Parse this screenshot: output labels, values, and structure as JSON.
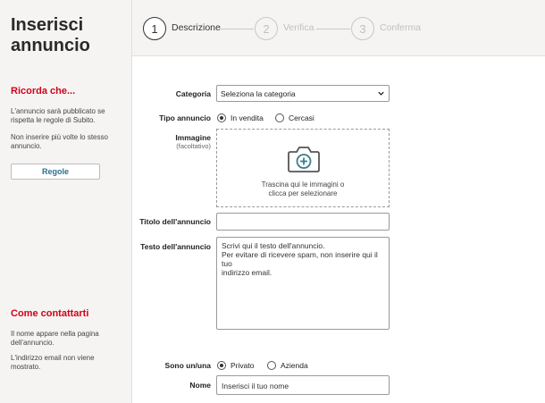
{
  "page": {
    "title_line1": "Inserisci",
    "title_line2": "annuncio"
  },
  "sidebar": {
    "reminder_heading": "Ricorda che...",
    "reminder_text1": "L'annuncio sarà pubblicato se rispetta le regole di Subito.",
    "reminder_text2": "Non inserire più volte lo stesso annuncio.",
    "rules_button": "Regole",
    "contact_heading": "Come contattarti",
    "contact_text1": "Il nome appare nella pagina dell'annuncio.",
    "contact_text2": "L'indirizzo email non viene mostrato."
  },
  "steps": [
    {
      "number": "1",
      "label": "Descrizione",
      "active": true
    },
    {
      "number": "2",
      "label": "Verifica",
      "active": false
    },
    {
      "number": "3",
      "label": "Conferma",
      "active": false
    }
  ],
  "form": {
    "category_label": "Categoria",
    "category_value": "Seleziona la categoria",
    "type_label": "Tipo annuncio",
    "type_option1": "In vendita",
    "type_option2": "Cercasi",
    "type_selected": "In vendita",
    "image_label": "Immagine",
    "image_sublabel": "(facoltativo)",
    "image_drop_line1": "Trascina qui le immagini o",
    "image_drop_line2": "clicca per selezionare",
    "ad_title_label": "Titolo dell'annuncio",
    "ad_title_value": "",
    "ad_text_label": "Testo dell'annuncio",
    "ad_text_placeholder_line1": "Scrivi qui il testo dell'annuncio.",
    "ad_text_placeholder_line2": "Per evitare di ricevere spam, non inserire qui il tuo",
    "ad_text_placeholder_line3": "indirizzo email.",
    "seller_label": "Sono un/una",
    "seller_option1": "Privato",
    "seller_option2": "Azienda",
    "seller_selected": "Privato",
    "name_label": "Nome",
    "name_placeholder": "Inserisci il tuo nome"
  },
  "colors": {
    "accent_red": "#d0021b",
    "link_blue": "#2b6f8f",
    "teal_icon": "#3a7d8c"
  },
  "icons": {
    "image_upload": "camera-plus-icon",
    "select_arrow": "chevron-down-icon"
  }
}
